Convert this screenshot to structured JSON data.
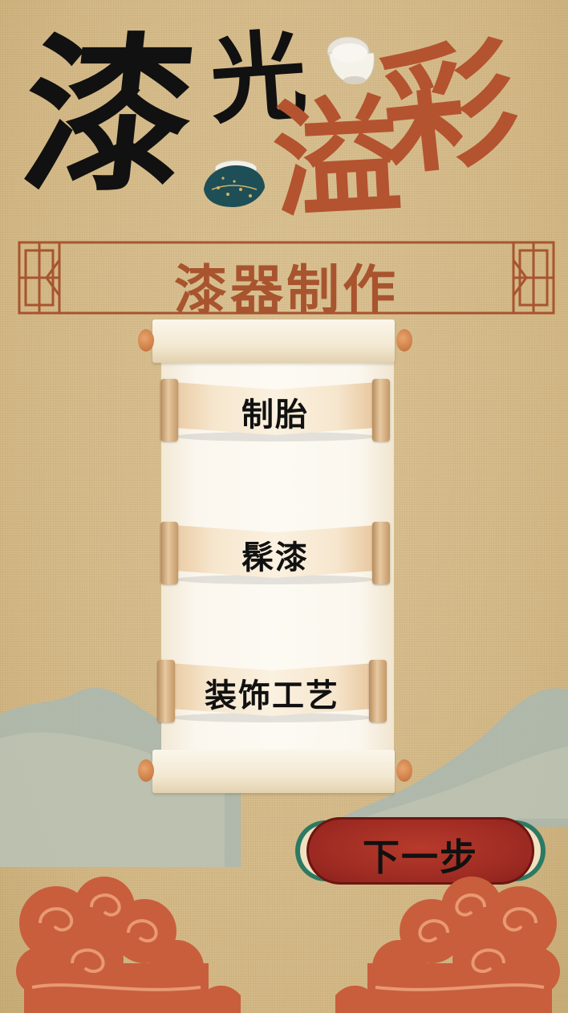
{
  "title": {
    "char1": "漆",
    "char2": "光",
    "char3": "溢",
    "char4": "彩"
  },
  "banner": {
    "text": "漆器制作"
  },
  "menu": {
    "items": [
      {
        "label": "制胎"
      },
      {
        "label": "髹漆"
      },
      {
        "label": "装饰工艺"
      }
    ]
  },
  "next_button": {
    "label": "下一步"
  },
  "colors": {
    "background": "#d8bf8c",
    "title_black": "#111111",
    "title_red": "#b4532f",
    "banner_brown": "#a8542f",
    "button_red": "#9c2a22",
    "cloud_orange": "#c95e3c",
    "mountain_blue": "#9fb3ad"
  }
}
